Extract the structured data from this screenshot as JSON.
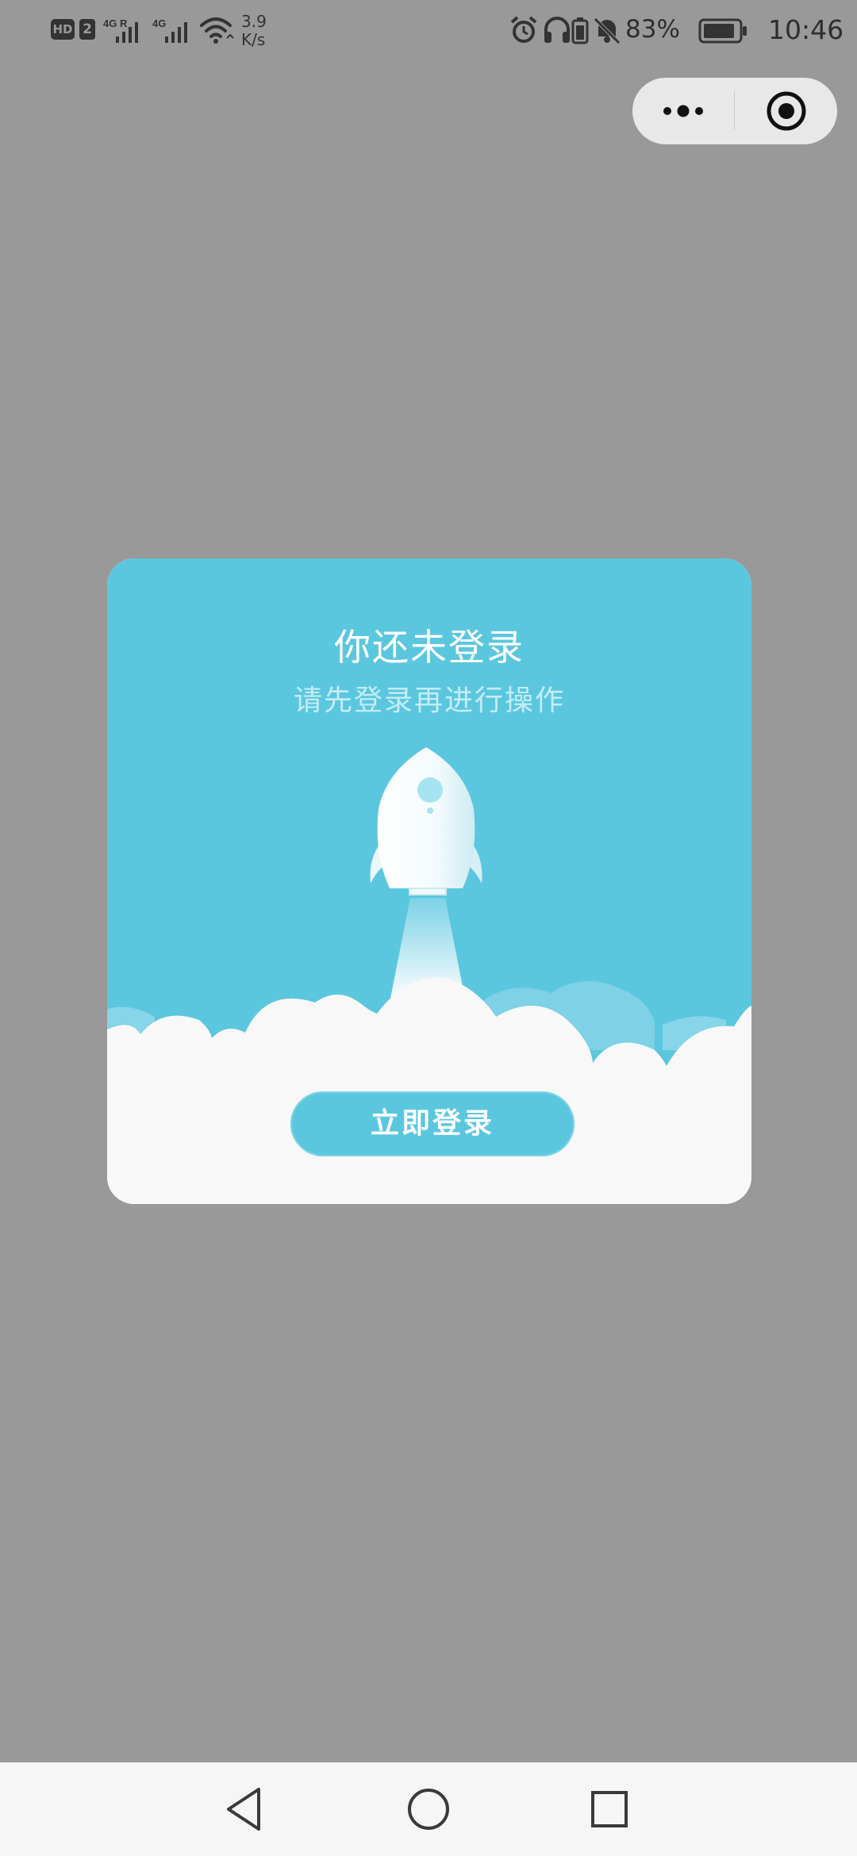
{
  "status_bar": {
    "hd_label": "HD",
    "sim_label": "2",
    "signal1_label": "4G R",
    "signal2_label": "4G",
    "net_speed_value": "3.9",
    "net_speed_unit": "K/s",
    "battery_percent": "83%",
    "time": "10:46",
    "icons": [
      "hd-icon",
      "sim2-icon",
      "signal-icon",
      "wifi-icon",
      "alarm-icon",
      "headset-icon",
      "battery-saver-icon",
      "bell-mute-icon",
      "battery-icon"
    ]
  },
  "capsule": {
    "more_icon": "more-dots-icon",
    "close_icon": "target-circle-icon"
  },
  "modal": {
    "title": "你还未登录",
    "subtitle": "请先登录再进行操作",
    "illustration": "rocket-launch-clouds",
    "login_button_label": "立即登录",
    "colors": {
      "sky": "#5bc7df",
      "cloud": "#f8f8f8",
      "button": "#5bc7df",
      "overlay": "#999999"
    }
  },
  "nav_bar": {
    "icons": [
      "back-triangle-icon",
      "home-circle-icon",
      "recent-square-icon"
    ]
  }
}
